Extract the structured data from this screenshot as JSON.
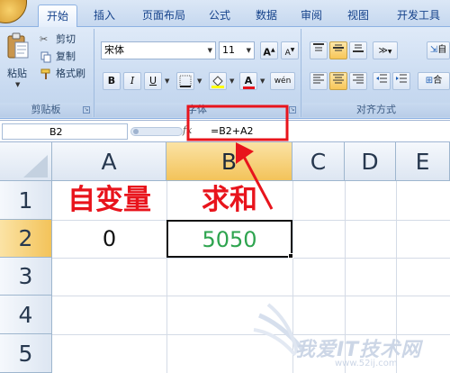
{
  "tabs": [
    {
      "label": "开始",
      "active": true
    },
    {
      "label": "插入"
    },
    {
      "label": "页面布局"
    },
    {
      "label": "公式"
    },
    {
      "label": "数据"
    },
    {
      "label": "审阅"
    },
    {
      "label": "视图"
    },
    {
      "label": "开发工具"
    }
  ],
  "clipboard": {
    "paste_label": "粘贴",
    "cut_label": "剪切",
    "copy_label": "复制",
    "format_painter_label": "格式刷",
    "group_label": "剪贴板"
  },
  "font": {
    "font_name": "宋体",
    "font_size": "11",
    "bold": "B",
    "italic": "I",
    "underline": "U",
    "grow": "A",
    "shrink": "A",
    "font_color_label": "A",
    "phonetic_label": "wén",
    "group_label": "字体"
  },
  "alignment": {
    "group_label": "对齐方式",
    "wrap_label": "自",
    "merge_label": "合"
  },
  "formula_bar": {
    "name_box": "B2",
    "fx_label": "fx",
    "formula": "=B2+A2"
  },
  "sheet": {
    "columns": [
      "A",
      "B",
      "C",
      "D",
      "E"
    ],
    "rows": [
      "1",
      "2",
      "3",
      "4",
      "5"
    ],
    "cells": {
      "A1": "自变量",
      "B1": "求和",
      "A2": "0",
      "B2": "5050"
    }
  },
  "colors": {
    "annotation_red": "#e8141c",
    "result_green": "#2ea44f",
    "accent_blue": "#15428b"
  },
  "watermark": {
    "text": "我爱IT技术网",
    "url": "www.52ij.com"
  }
}
